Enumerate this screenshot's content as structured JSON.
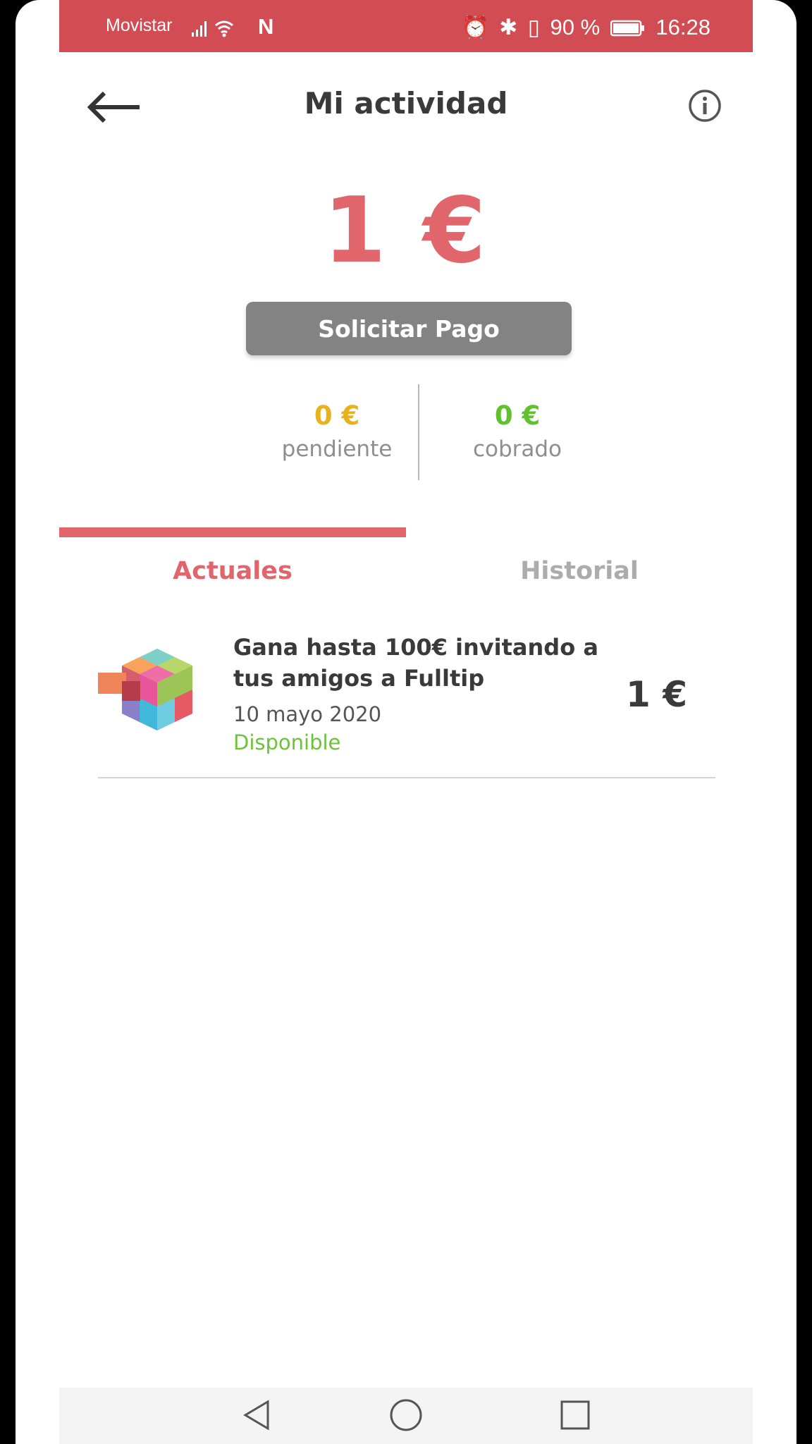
{
  "status_bar": {
    "carrier": "Movistar",
    "signal": ".ıll",
    "network_badge": "N",
    "battery_percent": "90 %",
    "time": "16:28",
    "icons": [
      "signal-icon",
      "wifi-icon",
      "alarm-icon",
      "bluetooth-icon",
      "vibrate-icon",
      "battery-icon"
    ]
  },
  "header": {
    "title": "Mi actividad",
    "back_icon": "back-arrow-icon",
    "info_icon": "info-icon"
  },
  "balance": {
    "amount": "1 €"
  },
  "pay_button": {
    "label": "Solicitar Pago"
  },
  "stats": {
    "pending": {
      "value": "0 €",
      "label": "pendiente"
    },
    "collected": {
      "value": "0 €",
      "label": "cobrado"
    }
  },
  "tabs": [
    {
      "label": "Actuales",
      "active": true
    },
    {
      "label": "Historial",
      "active": false
    }
  ],
  "activities": [
    {
      "title": "Gana hasta 100€ invitando a tus amigos a Fulltip",
      "date": "10 mayo 2020",
      "status": "Disponible",
      "amount": "1 €",
      "icon": "cube-logo-icon"
    }
  ],
  "nav_bar": {
    "buttons": [
      "back-triangle-icon",
      "home-circle-icon",
      "recents-square-icon"
    ]
  },
  "colors": {
    "brand": "#e0666b",
    "status_bar": "#d24d53",
    "pending": "#e8b21e",
    "collected": "#62c12e",
    "button": "#838383"
  }
}
